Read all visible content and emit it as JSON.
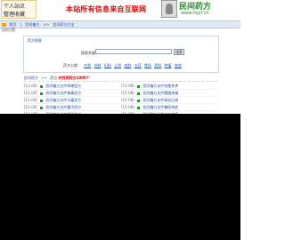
{
  "header": {
    "logo_left_top": "个人站点",
    "logo_left_bottom": "整理收藏",
    "slogan": "本站所有信息来自互联网",
    "brand_name": "民间药方",
    "brand_url": "www.mjyf.cn"
  },
  "nav": {
    "items": [
      "首页",
      "|",
      "民间偏方",
      ">>",
      "民间药方大全"
    ],
    "sub_text": "当前位置"
  },
  "search": {
    "panel_title": "药方搜索",
    "label": "搜索关键字：",
    "input_value": "",
    "button": "搜索",
    "category_label": "药方分类：",
    "categories": [
      "内科",
      "外科",
      "妇科",
      "儿科",
      "皮肤",
      "五官",
      "骨科",
      "男科",
      "肿瘤",
      "其他"
    ]
  },
  "list": {
    "breadcrumb": "民间药方",
    "sep": ">>",
    "tag": "药方",
    "count_label": "共找到药方1000个",
    "rows": [
      {
        "left_date": "[12-08]",
        "left_title": "民间偏方治疗咳嗽验方",
        "right_date": "[12-08]",
        "right_title": "民间偏方治疗失眠多梦"
      },
      {
        "left_date": "[12-08]",
        "left_title": "民间偏方治疗胃痛验方",
        "right_date": "[12-08]",
        "right_title": "民间偏方治疗腰腿疼痛"
      },
      {
        "left_date": "[12-08]",
        "left_title": "民间偏方治疗头痛验方",
        "right_date": "[12-08]",
        "right_title": "民间偏方治疗高血压病"
      },
      {
        "left_date": "[12-08]",
        "left_title": "民间偏方治疗腹泻验方",
        "right_date": "[12-08]",
        "right_title": "民间偏方治疗糖尿病症"
      },
      {
        "left_date": "[12-08]",
        "left_title": "民间偏方治疗便秘验方",
        "right_date": "[12-08]",
        "right_title": "民间偏方治疗关节疼痛"
      }
    ]
  },
  "colors": {
    "slogan": "#e00000",
    "link": "#1a4fa0",
    "brand": "#2a8a2a",
    "footer": "#000000"
  }
}
